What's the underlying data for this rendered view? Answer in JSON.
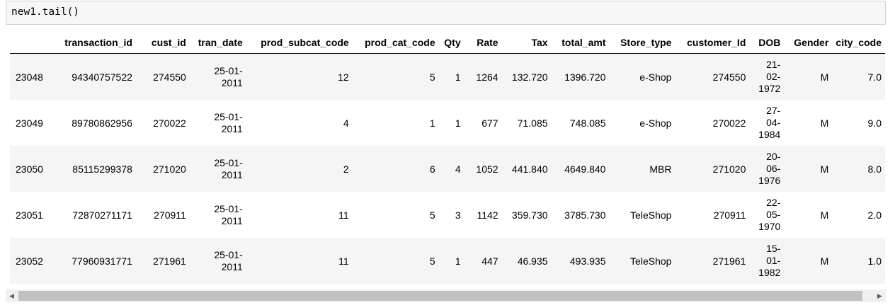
{
  "code_cell": {
    "input_code": "new1.tail()"
  },
  "dataframe": {
    "columns": [
      "",
      "transaction_id",
      "cust_id",
      "tran_date",
      "prod_subcat_code",
      "prod_cat_code",
      "Qty",
      "Rate",
      "Tax",
      "total_amt",
      "Store_type",
      "customer_Id",
      "DOB",
      "Gender",
      "city_code"
    ],
    "rows": [
      [
        "23048",
        "94340757522",
        "274550",
        "25-01-2011",
        "12",
        "5",
        "1",
        "1264",
        "132.720",
        "1396.720",
        "e-Shop",
        "274550",
        "21-02-1972",
        "M",
        "7.0"
      ],
      [
        "23049",
        "89780862956",
        "270022",
        "25-01-2011",
        "4",
        "1",
        "1",
        "677",
        "71.085",
        "748.085",
        "e-Shop",
        "270022",
        "27-04-1984",
        "M",
        "9.0"
      ],
      [
        "23050",
        "85115299378",
        "271020",
        "25-01-2011",
        "2",
        "6",
        "4",
        "1052",
        "441.840",
        "4649.840",
        "MBR",
        "271020",
        "20-06-1976",
        "M",
        "8.0"
      ],
      [
        "23051",
        "72870271171",
        "270911",
        "25-01-2011",
        "11",
        "5",
        "3",
        "1142",
        "359.730",
        "3785.730",
        "TeleShop",
        "270911",
        "22-05-1970",
        "M",
        "2.0"
      ],
      [
        "23052",
        "77960931771",
        "271961",
        "25-01-2011",
        "11",
        "5",
        "1",
        "447",
        "46.935",
        "493.935",
        "TeleShop",
        "271961",
        "15-01-1982",
        "M",
        "1.0"
      ]
    ]
  },
  "scrollbar": {
    "left_arrow_icon": "◀",
    "right_arrow_icon": "▶"
  }
}
